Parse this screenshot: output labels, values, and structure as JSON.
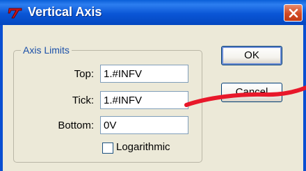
{
  "window": {
    "title": "Vertical Axis",
    "close_icon": "close-icon"
  },
  "groupbox": {
    "legend": "Axis Limits"
  },
  "fields": {
    "top": {
      "label": "Top:",
      "value": "1.#INFV"
    },
    "tick": {
      "label": "Tick:",
      "value": "1.#INFV"
    },
    "bottom": {
      "label": "Bottom:",
      "value": "0V"
    }
  },
  "logarithmic": {
    "label": "Logarithmic",
    "checked": false
  },
  "buttons": {
    "ok": "OK",
    "cancel": "Cancel"
  },
  "colors": {
    "titlebar": "#0a56d6",
    "close_button": "#d24a24",
    "annotation_stroke": "#e8182a",
    "dialog_bg": "#ece9d8"
  }
}
